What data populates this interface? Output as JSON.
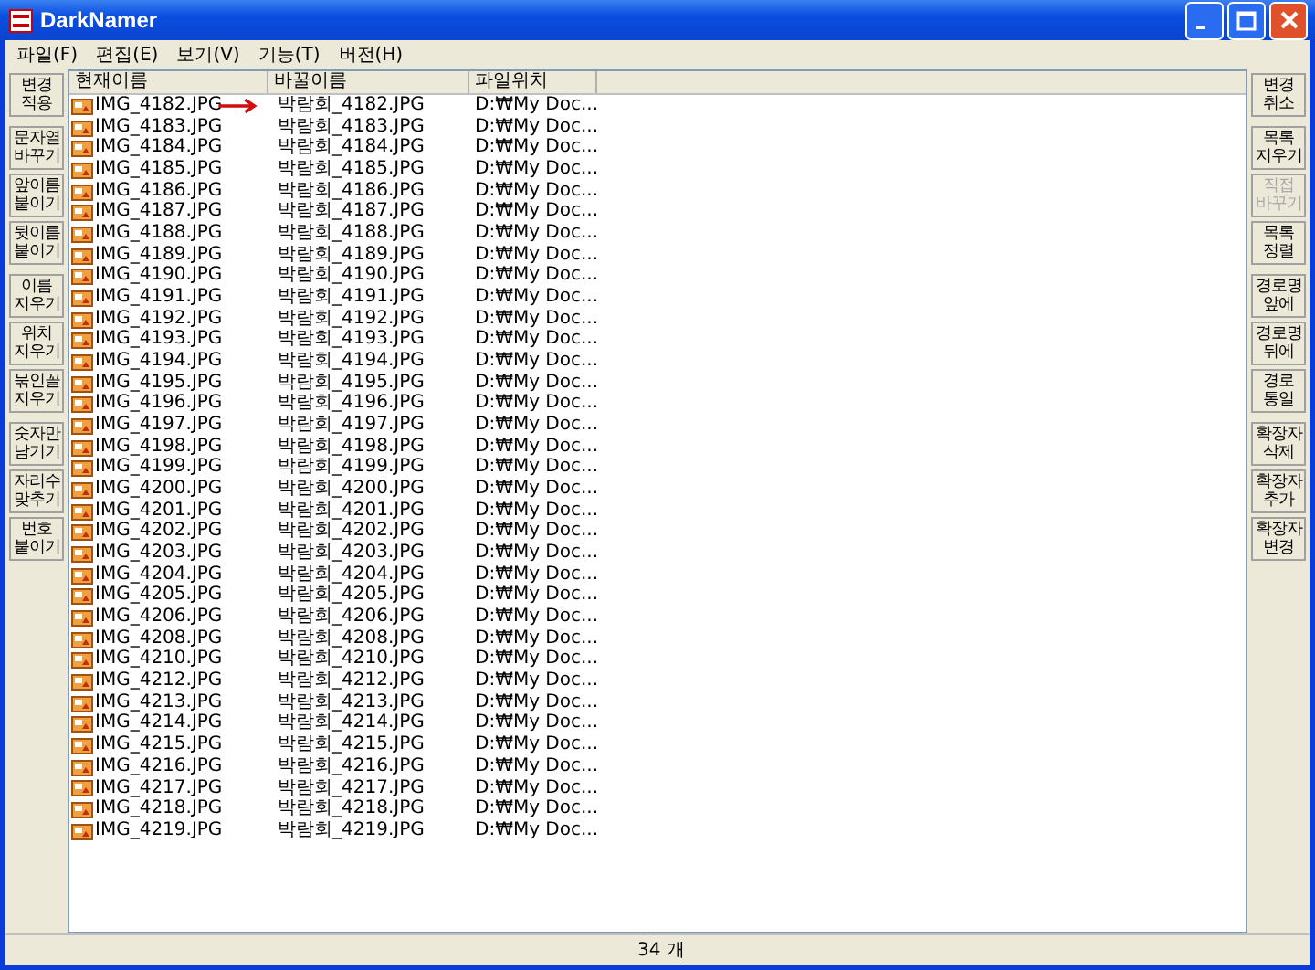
{
  "window": {
    "title": "DarkNamer"
  },
  "menu": [
    "파일(F)",
    "편집(E)",
    "보기(V)",
    "기능(T)",
    "버전(H)"
  ],
  "left_buttons": [
    [
      {
        "label": "변경\n적용",
        "disabled": false
      }
    ],
    [
      {
        "label": "문자열\n바꾸기",
        "disabled": false
      },
      {
        "label": "앞이름\n붙이기",
        "disabled": false
      },
      {
        "label": "뒷이름\n붙이기",
        "disabled": false
      }
    ],
    [
      {
        "label": "이름\n지우기",
        "disabled": false
      },
      {
        "label": "위치\n지우기",
        "disabled": false
      },
      {
        "label": "묶인꼴\n지우기",
        "disabled": false
      }
    ],
    [
      {
        "label": "숫자만\n남기기",
        "disabled": false
      },
      {
        "label": "자리수\n맞추기",
        "disabled": false
      },
      {
        "label": "번호\n붙이기",
        "disabled": false
      }
    ]
  ],
  "right_buttons": [
    [
      {
        "label": "변경\n취소",
        "disabled": false
      }
    ],
    [
      {
        "label": "목록\n지우기",
        "disabled": false
      },
      {
        "label": "직접\n바꾸기",
        "disabled": true
      },
      {
        "label": "목록\n정렬",
        "disabled": false
      }
    ],
    [
      {
        "label": "경로명\n앞에",
        "disabled": false
      },
      {
        "label": "경로명\n뒤에",
        "disabled": false
      },
      {
        "label": "경로\n통일",
        "disabled": false
      }
    ],
    [
      {
        "label": "확장자\n삭제",
        "disabled": false
      },
      {
        "label": "확장자\n추가",
        "disabled": false
      },
      {
        "label": "확장자\n변경",
        "disabled": false
      }
    ]
  ],
  "table": {
    "columns": [
      "현재이름",
      "바꿀이름",
      "파일위치"
    ],
    "rows": [
      {
        "current": "IMG_4182.JPG",
        "new": "박람회_4182.JPG",
        "location": "D:₩My Doc...",
        "marked": true
      },
      {
        "current": "IMG_4183.JPG",
        "new": "박람회_4183.JPG",
        "location": "D:₩My Doc...",
        "marked": false
      },
      {
        "current": "IMG_4184.JPG",
        "new": "박람회_4184.JPG",
        "location": "D:₩My Doc...",
        "marked": false
      },
      {
        "current": "IMG_4185.JPG",
        "new": "박람회_4185.JPG",
        "location": "D:₩My Doc...",
        "marked": false
      },
      {
        "current": "IMG_4186.JPG",
        "new": "박람회_4186.JPG",
        "location": "D:₩My Doc...",
        "marked": false
      },
      {
        "current": "IMG_4187.JPG",
        "new": "박람회_4187.JPG",
        "location": "D:₩My Doc...",
        "marked": false
      },
      {
        "current": "IMG_4188.JPG",
        "new": "박람회_4188.JPG",
        "location": "D:₩My Doc...",
        "marked": false
      },
      {
        "current": "IMG_4189.JPG",
        "new": "박람회_4189.JPG",
        "location": "D:₩My Doc...",
        "marked": false
      },
      {
        "current": "IMG_4190.JPG",
        "new": "박람회_4190.JPG",
        "location": "D:₩My Doc...",
        "marked": false
      },
      {
        "current": "IMG_4191.JPG",
        "new": "박람회_4191.JPG",
        "location": "D:₩My Doc...",
        "marked": false
      },
      {
        "current": "IMG_4192.JPG",
        "new": "박람회_4192.JPG",
        "location": "D:₩My Doc...",
        "marked": false
      },
      {
        "current": "IMG_4193.JPG",
        "new": "박람회_4193.JPG",
        "location": "D:₩My Doc...",
        "marked": false
      },
      {
        "current": "IMG_4194.JPG",
        "new": "박람회_4194.JPG",
        "location": "D:₩My Doc...",
        "marked": false
      },
      {
        "current": "IMG_4195.JPG",
        "new": "박람회_4195.JPG",
        "location": "D:₩My Doc...",
        "marked": false
      },
      {
        "current": "IMG_4196.JPG",
        "new": "박람회_4196.JPG",
        "location": "D:₩My Doc...",
        "marked": false
      },
      {
        "current": "IMG_4197.JPG",
        "new": "박람회_4197.JPG",
        "location": "D:₩My Doc...",
        "marked": false
      },
      {
        "current": "IMG_4198.JPG",
        "new": "박람회_4198.JPG",
        "location": "D:₩My Doc...",
        "marked": false
      },
      {
        "current": "IMG_4199.JPG",
        "new": "박람회_4199.JPG",
        "location": "D:₩My Doc...",
        "marked": false
      },
      {
        "current": "IMG_4200.JPG",
        "new": "박람회_4200.JPG",
        "location": "D:₩My Doc...",
        "marked": false
      },
      {
        "current": "IMG_4201.JPG",
        "new": "박람회_4201.JPG",
        "location": "D:₩My Doc...",
        "marked": false
      },
      {
        "current": "IMG_4202.JPG",
        "new": "박람회_4202.JPG",
        "location": "D:₩My Doc...",
        "marked": false
      },
      {
        "current": "IMG_4203.JPG",
        "new": "박람회_4203.JPG",
        "location": "D:₩My Doc...",
        "marked": false
      },
      {
        "current": "IMG_4204.JPG",
        "new": "박람회_4204.JPG",
        "location": "D:₩My Doc...",
        "marked": false
      },
      {
        "current": "IMG_4205.JPG",
        "new": "박람회_4205.JPG",
        "location": "D:₩My Doc...",
        "marked": false
      },
      {
        "current": "IMG_4206.JPG",
        "new": "박람회_4206.JPG",
        "location": "D:₩My Doc...",
        "marked": false
      },
      {
        "current": "IMG_4208.JPG",
        "new": "박람회_4208.JPG",
        "location": "D:₩My Doc...",
        "marked": false
      },
      {
        "current": "IMG_4210.JPG",
        "new": "박람회_4210.JPG",
        "location": "D:₩My Doc...",
        "marked": false
      },
      {
        "current": "IMG_4212.JPG",
        "new": "박람회_4212.JPG",
        "location": "D:₩My Doc...",
        "marked": false
      },
      {
        "current": "IMG_4213.JPG",
        "new": "박람회_4213.JPG",
        "location": "D:₩My Doc...",
        "marked": false
      },
      {
        "current": "IMG_4214.JPG",
        "new": "박람회_4214.JPG",
        "location": "D:₩My Doc...",
        "marked": false
      },
      {
        "current": "IMG_4215.JPG",
        "new": "박람회_4215.JPG",
        "location": "D:₩My Doc...",
        "marked": false
      },
      {
        "current": "IMG_4216.JPG",
        "new": "박람회_4216.JPG",
        "location": "D:₩My Doc...",
        "marked": false
      },
      {
        "current": "IMG_4217.JPG",
        "new": "박람회_4217.JPG",
        "location": "D:₩My Doc...",
        "marked": false
      },
      {
        "current": "IMG_4218.JPG",
        "new": "박람회_4218.JPG",
        "location": "D:₩My Doc...",
        "marked": false
      },
      {
        "current": "IMG_4219.JPG",
        "new": "박람회_4219.JPG",
        "location": "D:₩My Doc...",
        "marked": false
      }
    ]
  },
  "status_bar": {
    "count": "34 개"
  }
}
